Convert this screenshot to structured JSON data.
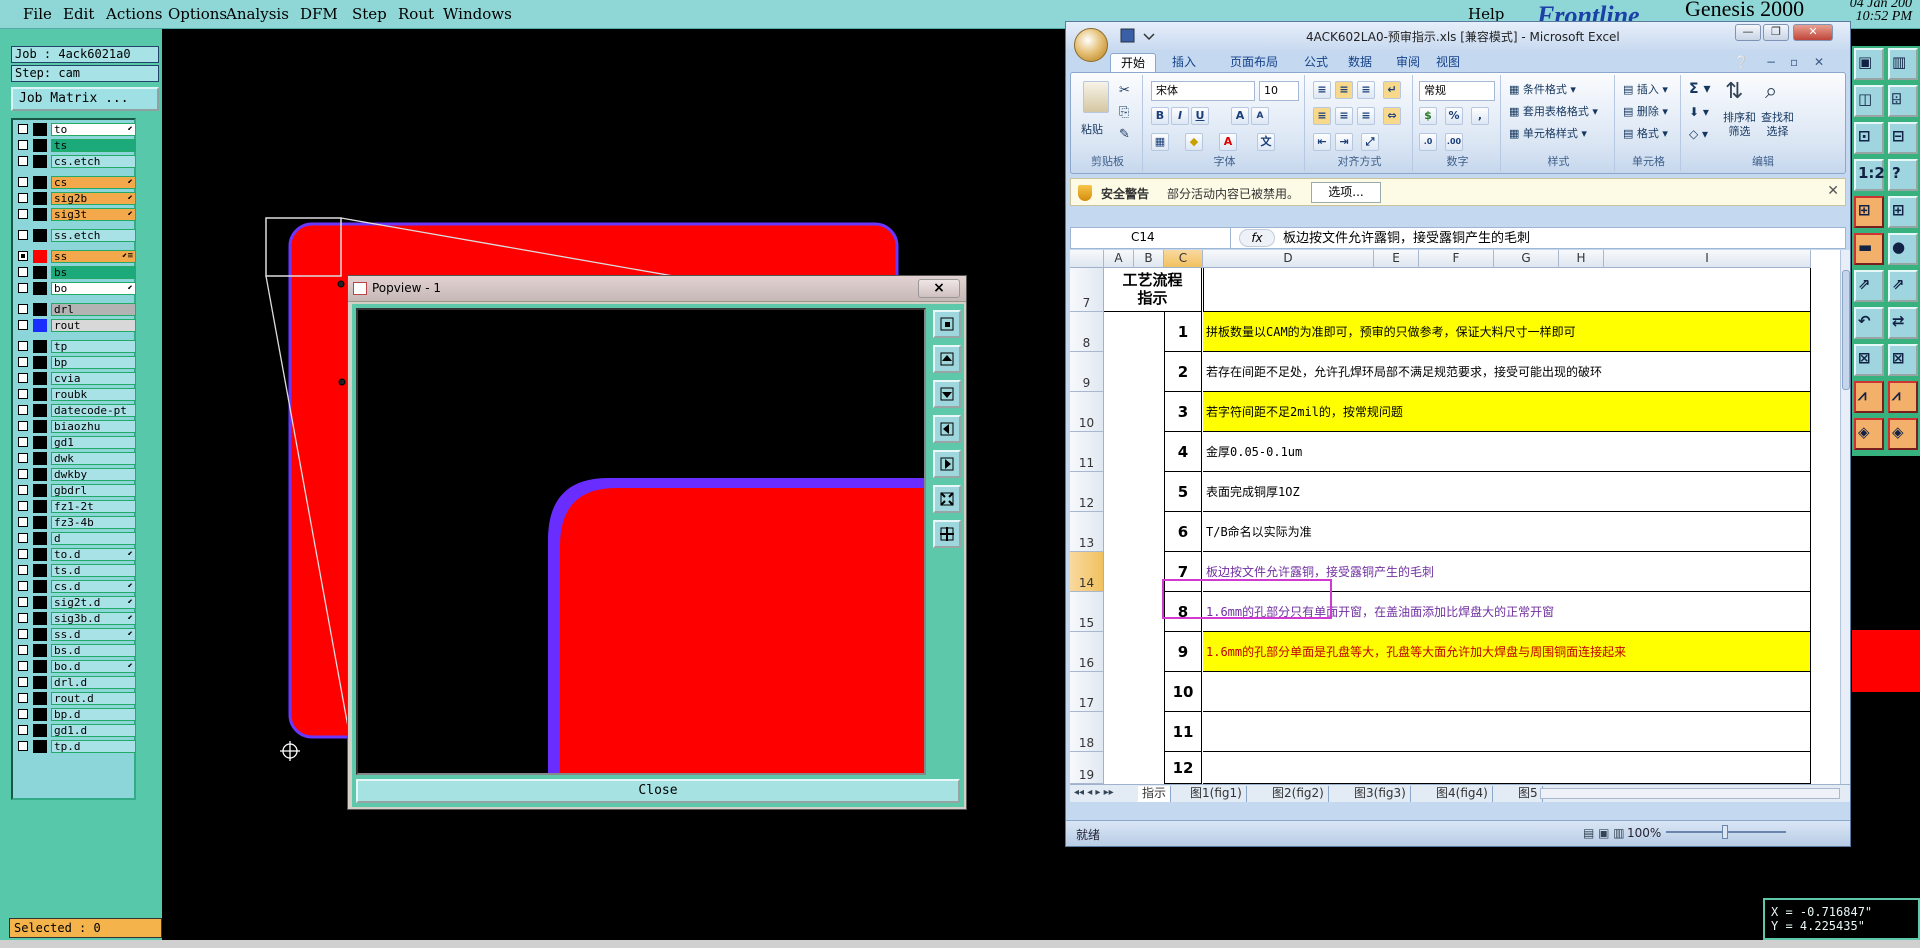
{
  "menubar": {
    "items": [
      "File",
      "Edit",
      "Actions",
      "Options",
      "Analysis",
      "DFM",
      "Step",
      "Rout",
      "Windows"
    ],
    "help": "Help",
    "brand": "Frontline",
    "product": "Genesis 2000",
    "date": "04 Jan 200",
    "time": "10:52 PM"
  },
  "job": {
    "label": "Job : 4ack6021a0",
    "step": "Step: cam",
    "matrix_button": "Job Matrix ..."
  },
  "layers": [
    {
      "name": "to",
      "color": "#ffffff",
      "checked": false,
      "bg": "#ffffff",
      "tag": "⬋"
    },
    {
      "name": "ts",
      "color": "#ffffff",
      "checked": false,
      "bg": "#1daa7a",
      "tag": ""
    },
    {
      "name": "cs.etch",
      "color": "#ffffff",
      "checked": false,
      "bg": "#a8e2e6",
      "tag": ""
    },
    {
      "name": "cs",
      "color": "#ffffff",
      "checked": false,
      "bg": "#f3a94b",
      "tag": "⬋"
    },
    {
      "name": "sig2b",
      "color": "#ffffff",
      "checked": false,
      "bg": "#f3a94b",
      "tag": "⬋"
    },
    {
      "name": "sig3t",
      "color": "#ffffff",
      "checked": false,
      "bg": "#f3a94b",
      "tag": "⬋"
    },
    {
      "name": "ss.etch",
      "color": "#ffffff",
      "checked": false,
      "bg": "#a8e2e6",
      "tag": ""
    },
    {
      "name": "ss",
      "color": "#ff0000",
      "checked": true,
      "bg": "#f3a94b",
      "tag": "⬋≡"
    },
    {
      "name": "bs",
      "color": "#ffffff",
      "checked": false,
      "bg": "#1daa7a",
      "tag": ""
    },
    {
      "name": "bo",
      "color": "#ffffff",
      "checked": false,
      "bg": "#ffffff",
      "tag": "⬋"
    },
    {
      "name": "drl",
      "color": "#ffffff",
      "checked": false,
      "bg": "#b3b3b3",
      "tag": ""
    },
    {
      "name": "rout",
      "color": "#1b2cff",
      "checked": false,
      "bg": "#d8d8d8",
      "tag": ""
    },
    {
      "name": "tp",
      "color": "#ffffff",
      "checked": false,
      "bg": "#a8e2e6",
      "tag": ""
    },
    {
      "name": "bp",
      "color": "#ffffff",
      "checked": false,
      "bg": "#a8e2e6",
      "tag": ""
    },
    {
      "name": "cvia",
      "color": "#ffffff",
      "checked": false,
      "bg": "#a8e2e6",
      "tag": ""
    },
    {
      "name": "roubk",
      "color": "#ffffff",
      "checked": false,
      "bg": "#a8e2e6",
      "tag": ""
    },
    {
      "name": "datecode-pt",
      "color": "#ffffff",
      "checked": false,
      "bg": "#a8e2e6",
      "tag": ""
    },
    {
      "name": "biaozhu",
      "color": "#ffffff",
      "checked": false,
      "bg": "#a8e2e6",
      "tag": ""
    },
    {
      "name": "gd1",
      "color": "#ffffff",
      "checked": false,
      "bg": "#a8e2e6",
      "tag": ""
    },
    {
      "name": "dwk",
      "color": "#ffffff",
      "checked": false,
      "bg": "#a8e2e6",
      "tag": ""
    },
    {
      "name": "dwkby",
      "color": "#ffffff",
      "checked": false,
      "bg": "#a8e2e6",
      "tag": ""
    },
    {
      "name": "gbdrl",
      "color": "#ffffff",
      "checked": false,
      "bg": "#a8e2e6",
      "tag": ""
    },
    {
      "name": "fz1-2t",
      "color": "#ffffff",
      "checked": false,
      "bg": "#a8e2e6",
      "tag": ""
    },
    {
      "name": "fz3-4b",
      "color": "#ffffff",
      "checked": false,
      "bg": "#a8e2e6",
      "tag": ""
    },
    {
      "name": "d",
      "color": "#ffffff",
      "checked": false,
      "bg": "#a8e2e6",
      "tag": ""
    },
    {
      "name": "to.d",
      "color": "#ffffff",
      "checked": false,
      "bg": "#a8e2e6",
      "tag": "⬋"
    },
    {
      "name": "ts.d",
      "color": "#ffffff",
      "checked": false,
      "bg": "#a8e2e6",
      "tag": ""
    },
    {
      "name": "cs.d",
      "color": "#ffffff",
      "checked": false,
      "bg": "#a8e2e6",
      "tag": "⬋"
    },
    {
      "name": "sig2t.d",
      "color": "#ffffff",
      "checked": false,
      "bg": "#a8e2e6",
      "tag": "⬋"
    },
    {
      "name": "sig3b.d",
      "color": "#ffffff",
      "checked": false,
      "bg": "#a8e2e6",
      "tag": "⬋"
    },
    {
      "name": "ss.d",
      "color": "#ffffff",
      "checked": false,
      "bg": "#a8e2e6",
      "tag": "⬋"
    },
    {
      "name": "bs.d",
      "color": "#ffffff",
      "checked": false,
      "bg": "#a8e2e6",
      "tag": ""
    },
    {
      "name": "bo.d",
      "color": "#ffffff",
      "checked": false,
      "bg": "#a8e2e6",
      "tag": "⬋"
    },
    {
      "name": "drl.d",
      "color": "#ffffff",
      "checked": false,
      "bg": "#a8e2e6",
      "tag": ""
    },
    {
      "name": "rout.d",
      "color": "#ffffff",
      "checked": false,
      "bg": "#a8e2e6",
      "tag": ""
    },
    {
      "name": "bp.d",
      "color": "#ffffff",
      "checked": false,
      "bg": "#a8e2e6",
      "tag": ""
    },
    {
      "name": "gd1.d",
      "color": "#ffffff",
      "checked": false,
      "bg": "#a8e2e6",
      "tag": ""
    },
    {
      "name": "tp.d",
      "color": "#ffffff",
      "checked": false,
      "bg": "#a8e2e6",
      "tag": ""
    }
  ],
  "status": {
    "selected": "Selected : 0"
  },
  "popview": {
    "title": "Popview - 1",
    "close_x": "×",
    "close_button": "Close"
  },
  "coords": {
    "x": "X = -0.716847\"",
    "y": "Y =  4.225435\""
  },
  "excel": {
    "title": "4ACK602LA0-预审指示.xls  [兼容模式] - Microsoft Excel",
    "tabs": [
      "开始",
      "插入",
      "页面布局",
      "公式",
      "数据",
      "审阅",
      "视图"
    ],
    "ribbon": {
      "clipboard": "剪贴板",
      "paste": "粘贴",
      "font_group": "字体",
      "font_name": "宋体",
      "font_size": "10",
      "align_group": "对齐方式",
      "number_group": "数字",
      "number_format": "常规",
      "styles_group": "样式",
      "cond_format": "条件格式",
      "table_format": "套用表格格式",
      "cell_styles": "单元格样式",
      "cells_group": "单元格",
      "insert": "插入",
      "delete": "删除",
      "format": "格式",
      "edit_group": "编辑",
      "sort": "排序和\n筛选",
      "find": "查找和\n选择"
    },
    "security": {
      "title": "安全警告",
      "message": "部分活动内容已被禁用。",
      "options": "选项..."
    },
    "namebox": "C14",
    "formula": "板边按文件允许露铜，接受露铜产生的毛刺",
    "columns": [
      "A",
      "B",
      "C",
      "D",
      "E",
      "F",
      "G",
      "H",
      "I"
    ],
    "header_cell": "工艺流程\n指示",
    "rows": [
      {
        "row": "7",
        "num": "",
        "text": ""
      },
      {
        "row": "8",
        "num": "1",
        "text": "拼板数量以CAM的为准即可，预审的只做参考，保证大料尺寸一样即可",
        "bg": "#ffff00",
        "color": "#000000"
      },
      {
        "row": "9",
        "num": "2",
        "text": "若存在间距不足处，允许孔焊环局部不满足规范要求，接受可能出现的破环",
        "bg": "#ffffff",
        "color": "#000000"
      },
      {
        "row": "10",
        "num": "3",
        "text": "若字符间距不足2mil的，按常规问题",
        "bg": "#ffff00",
        "color": "#000000"
      },
      {
        "row": "11",
        "num": "4",
        "text": "金厚0.05-0.1um",
        "bg": "#ffffff",
        "color": "#000000"
      },
      {
        "row": "12",
        "num": "5",
        "text": "表面完成铜厚1OZ",
        "bg": "#ffffff",
        "color": "#000000"
      },
      {
        "row": "13",
        "num": "6",
        "text": "T/B命名以实际为准",
        "bg": "#ffffff",
        "color": "#000000"
      },
      {
        "row": "14",
        "num": "7",
        "text": "板边按文件允许露铜，接受露铜产生的毛刺",
        "bg": "#ffffff",
        "color": "#7030a0"
      },
      {
        "row": "15",
        "num": "8",
        "text": "1.6mm的孔部分只有单面开窗，在盖油面添加比焊盘大的正常开窗",
        "bg": "#ffffff",
        "color": "#7030a0"
      },
      {
        "row": "16",
        "num": "9",
        "text": "1.6mm的孔部分单面是孔盘等大，孔盘等大面允许加大焊盘与周围铜面连接起来",
        "bg": "#ffff00",
        "color": "#c00000"
      },
      {
        "row": "17",
        "num": "10",
        "text": "",
        "bg": "#ffffff",
        "color": "#000000"
      },
      {
        "row": "18",
        "num": "11",
        "text": "",
        "bg": "#ffffff",
        "color": "#000000"
      },
      {
        "row": "19",
        "num": "12",
        "text": "",
        "bg": "#ffffff",
        "color": "#000000"
      }
    ],
    "sheets": [
      "指示",
      "图1(fig1)",
      "图2(fig2)",
      "图3(fig3)",
      "图4(fig4)",
      "图5"
    ],
    "status": "就绪",
    "zoom": "100%"
  }
}
